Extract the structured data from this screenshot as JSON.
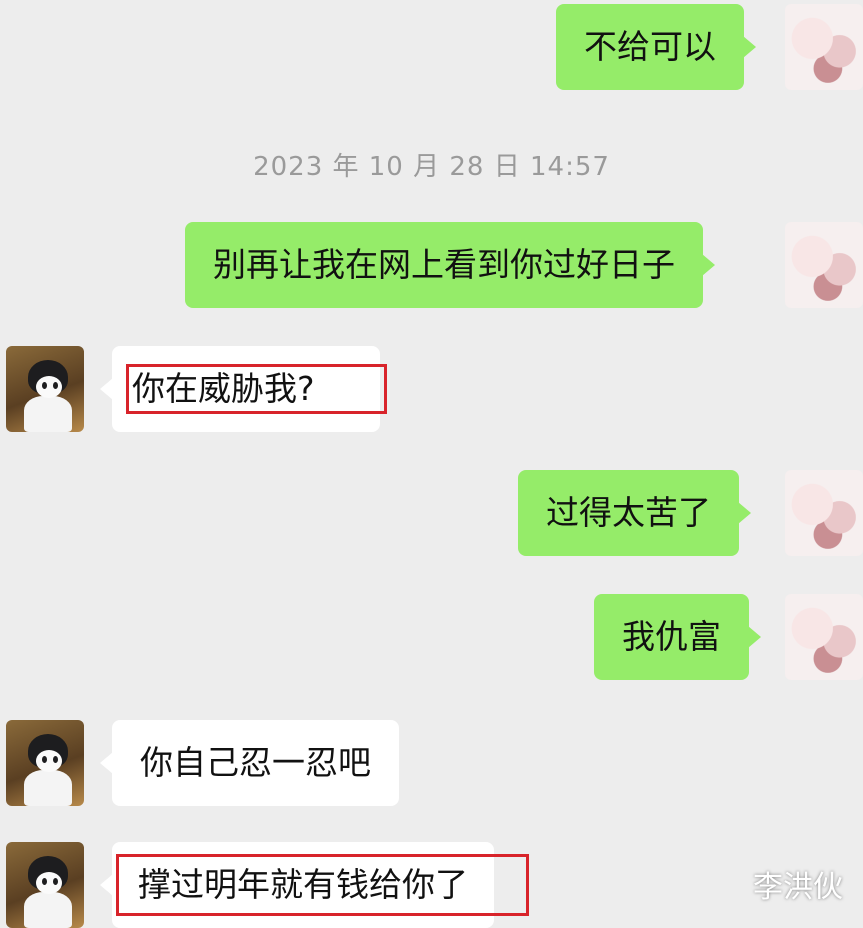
{
  "timestamp": "2023 年 10 月 28 日 14:57",
  "watermark": "李洪伙",
  "messages": [
    {
      "side": "right",
      "text": "不给可以"
    },
    {
      "side": "right",
      "text": "别再让我在网上看到你过好日子"
    },
    {
      "side": "left",
      "text": "你在威胁我?",
      "highlighted": true
    },
    {
      "side": "right",
      "text": "过得太苦了"
    },
    {
      "side": "right",
      "text": "我仇富"
    },
    {
      "side": "left",
      "text": "你自己忍一忍吧"
    },
    {
      "side": "left",
      "text": "撑过明年就有钱给你了",
      "highlighted": true
    }
  ],
  "colors": {
    "sent_bubble": "#95ec69",
    "received_bubble": "#ffffff",
    "highlight_box": "#d8232a",
    "background": "#ededed"
  }
}
